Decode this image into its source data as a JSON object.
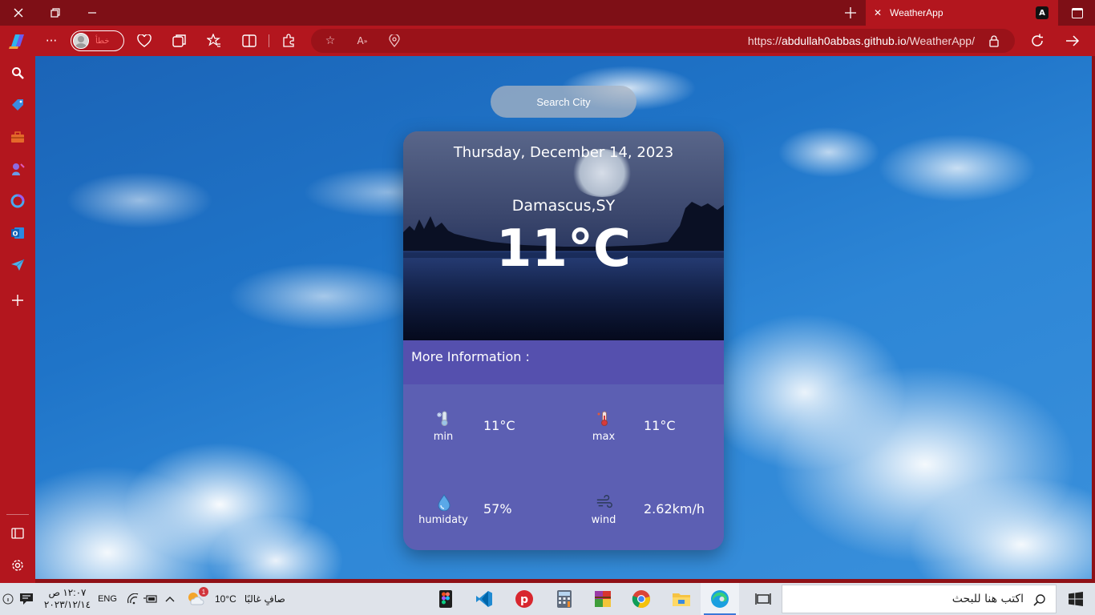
{
  "window": {
    "tab_title": "WeatherApp",
    "tab_badge": "A",
    "profile_status": "خطأ"
  },
  "address_bar": {
    "url_prefix": "https://",
    "url_host": "abdullah0abbas.github.io",
    "url_path": "/WeatherApp/"
  },
  "app": {
    "search_placeholder": "Search City",
    "date": "Thursday, December 14, 2023",
    "city": "Damascus,SY",
    "temperature": "11°C",
    "more_info_title": "More Information :",
    "stats": [
      {
        "label": "min",
        "value": "11°C",
        "icon": "cold-thermometer-icon"
      },
      {
        "label": "max",
        "value": "11°C",
        "icon": "hot-thermometer-icon"
      },
      {
        "label": "humidaty",
        "value": "57%",
        "icon": "humidity-drop-icon"
      },
      {
        "label": "wind",
        "value": "2.62km/h",
        "icon": "wind-icon"
      }
    ]
  },
  "taskbar": {
    "time": "١٢:٠٧ ص",
    "date": "٢٠٢٣/١٢/١٤",
    "language": "ENG",
    "weather_temp": "10°C",
    "weather_desc": "صافٍ غالبًا",
    "weather_badge": "1",
    "search_placeholder": "اكتب هنا للبحث"
  },
  "colors": {
    "browser_frame": "#b3161e",
    "title_bar": "#7e0f16",
    "card_info": "#5c5fb3",
    "card_header_bar": "#5550ae"
  }
}
